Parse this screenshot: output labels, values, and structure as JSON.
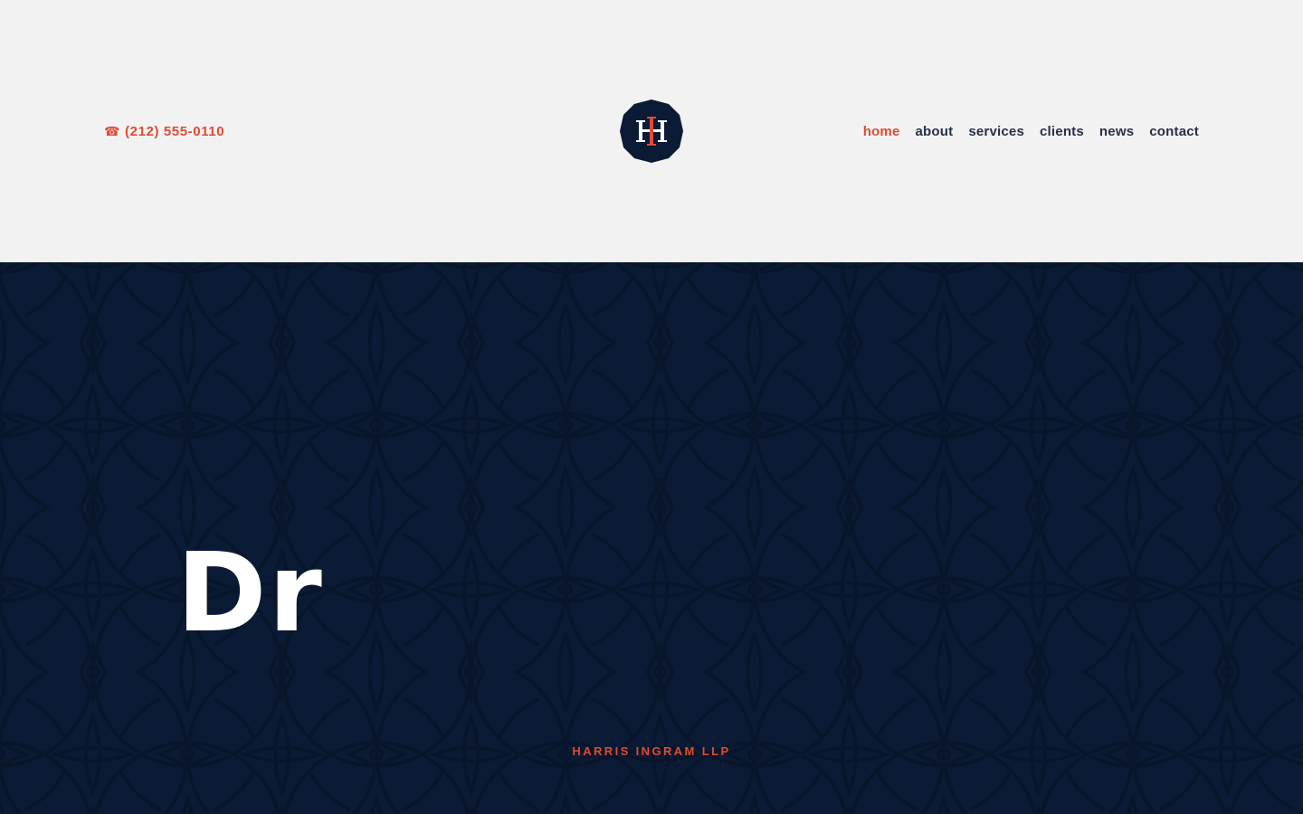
{
  "header": {
    "phone": {
      "icon": "phone-icon",
      "icon_glyph": "☎",
      "number": "(212) 555-0110"
    },
    "logo": {
      "initials": "HI",
      "icon": "logo-monogram"
    },
    "nav": [
      {
        "label": "home",
        "active": true
      },
      {
        "label": "about",
        "active": false
      },
      {
        "label": "services",
        "active": false
      },
      {
        "label": "clients",
        "active": false
      },
      {
        "label": "news",
        "active": false
      },
      {
        "label": "contact",
        "active": false
      }
    ]
  },
  "hero": {
    "eyebrow": "HARRIS INGRAM LLP",
    "headline_partial": "Dr"
  },
  "colors": {
    "accent": "#e24a33",
    "navy": "#0b1b35",
    "nav_text": "#243247",
    "background": "#f2f2f2"
  }
}
